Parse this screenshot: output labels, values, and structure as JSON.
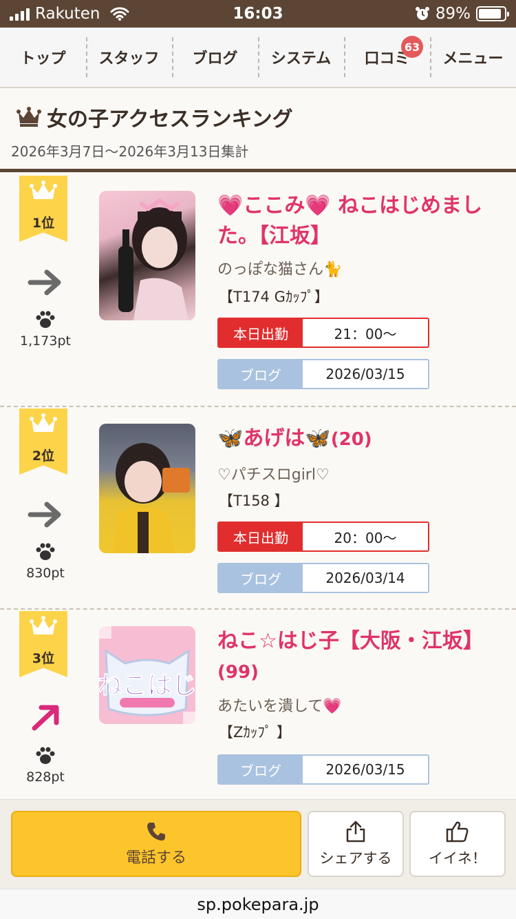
{
  "status_bar": {
    "carrier": "Rakuten",
    "time": "16:03",
    "battery": "89%",
    "battery_level": 0.89
  },
  "nav": {
    "items": [
      "トップ",
      "スタッフ",
      "ブログ",
      "システム",
      "口コミ",
      "メニュー"
    ],
    "review_badge": "63"
  },
  "heading": {
    "title": "女の子アクセスランキング",
    "period": "2026年3月7日〜2026年3月13日集計"
  },
  "ranking": [
    {
      "rank": "1位",
      "points": "1,173pt",
      "trend": "flat",
      "name": "💗ここみ💗 ねこはじめました。【江坂】",
      "age": "",
      "catch": "のっぽな猫さん🐈",
      "spec": "【T174 Gｶｯﾌﾟ】",
      "work_label": "本日出勤",
      "work_time": "21：00〜",
      "blog_label": "ブログ",
      "blog_date": "2026/03/15"
    },
    {
      "rank": "2位",
      "points": "830pt",
      "trend": "flat",
      "name": "🦋あげは🦋",
      "age": "(20)",
      "catch": "♡パチスロgirl♡",
      "spec": "【T158 】",
      "work_label": "本日出勤",
      "work_time": "20：00〜",
      "blog_label": "ブログ",
      "blog_date": "2026/03/14"
    },
    {
      "rank": "3位",
      "points": "828pt",
      "trend": "up",
      "name": "ねこ☆はじ子【大阪・江坂】",
      "age": "(99)",
      "catch": "あたいを潰して💗",
      "spec": "【Zｶｯﾌﾟ 】",
      "blog_label": "ブログ",
      "blog_date": "2026/03/15",
      "logo_text": "ねこはじ"
    }
  ],
  "bottom": {
    "call_label": "電話する",
    "share_label": "シェアする",
    "like_label": "イイネ！"
  },
  "url": "sp.pokepara.jp",
  "colors": {
    "brand_brown": "#5c4535",
    "ribbon_gold": "#fdd34a",
    "name_pink": "#e0336a",
    "work_red": "#e12d2d",
    "blog_blue": "#a9c2df",
    "call_yellow": "#fdc52c"
  }
}
